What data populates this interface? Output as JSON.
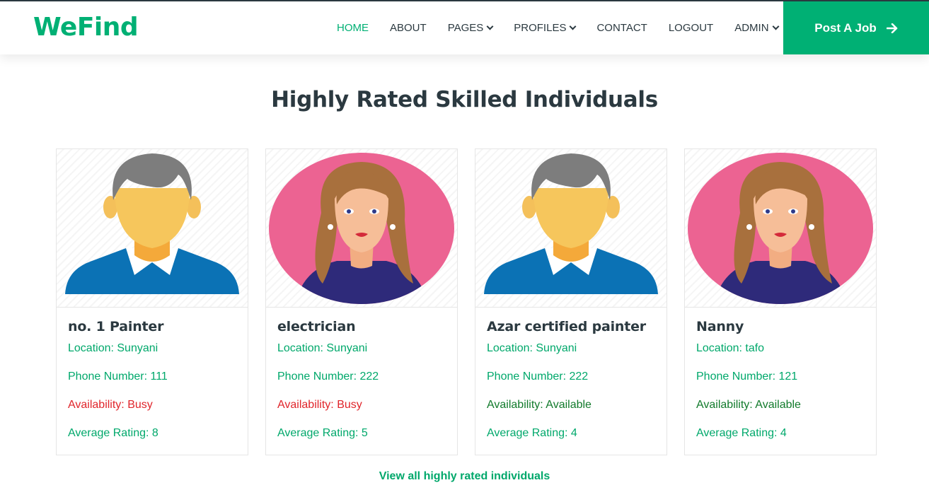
{
  "brand": {
    "name": "WeFind"
  },
  "nav": {
    "items": [
      {
        "label": "HOME",
        "dropdown": false,
        "active": true
      },
      {
        "label": "ABOUT",
        "dropdown": false
      },
      {
        "label": "PAGES",
        "dropdown": true
      },
      {
        "label": "PROFILES",
        "dropdown": true
      },
      {
        "label": "CONTACT",
        "dropdown": false
      },
      {
        "label": "LOGOUT",
        "dropdown": false
      },
      {
        "label": "ADMIN",
        "dropdown": true
      }
    ],
    "post_job_label": "Post A Job",
    "post_job_icon": "arrow-right-icon"
  },
  "section": {
    "title": "Highly Rated Skilled Individuals",
    "view_all": "View all highly rated individuals"
  },
  "cards": [
    {
      "avatar": "male-avatar-icon",
      "title": "no. 1 Painter",
      "location": "Location: Sunyani",
      "phone": "Phone Number: 111",
      "availability": "Availability: Busy",
      "status": "busy",
      "rating": "Average Rating: 8"
    },
    {
      "avatar": "female-avatar-icon",
      "title": "electrician",
      "location": "Location: Sunyani",
      "phone": "Phone Number: 222",
      "availability": "Availability: Busy",
      "status": "busy",
      "rating": "Average Rating: 5"
    },
    {
      "avatar": "male-avatar-icon",
      "title": "Azar certified painter",
      "location": "Location: Sunyani",
      "phone": "Phone Number: 222",
      "availability": "Availability: Available",
      "status": "available",
      "rating": "Average Rating: 4"
    },
    {
      "avatar": "female-avatar-icon",
      "title": "Nanny",
      "location": "Location: tafo",
      "phone": "Phone Number: 121",
      "availability": "Availability: Available",
      "status": "available",
      "rating": "Average Rating: 4"
    }
  ],
  "colors": {
    "accent": "#00b074",
    "busy": "#e0252b",
    "available": "#117a2b",
    "text": "#2b3940"
  }
}
